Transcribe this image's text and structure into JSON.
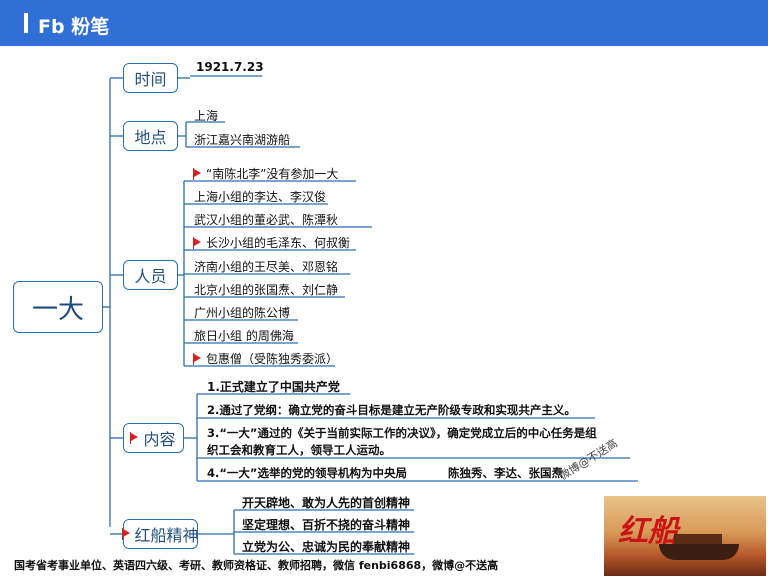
{
  "brand": {
    "name": "粉笔",
    "logo_text": "Fb",
    "color": "#2f6fd6"
  },
  "root": {
    "label": "一大"
  },
  "branches": {
    "time": {
      "label": "时间",
      "items": [
        "1921.7.23"
      ]
    },
    "place": {
      "label": "地点",
      "items": [
        "上海",
        "浙江嘉兴南湖游船"
      ]
    },
    "people": {
      "label": "人员",
      "items": [
        "“南陈北李”没有参加一大",
        "上海小组的李达、李汉俊",
        "武汉小组的董必武、陈潭秋",
        "长沙小组的毛泽东、何叔衡",
        "济南小组的王尽美、邓恩铭",
        "北京小组的张国焘、刘仁静",
        "广州小组的陈公博",
        "旅日小组 的周佛海",
        "包惠僧（受陈独秀委派）"
      ]
    },
    "content": {
      "label": "内容",
      "items": [
        "1.正式建立了中国共产党",
        "2.通过了党纲：确立党的奋斗目标是建立无产阶级专政和实现共产主义。",
        "3.“一大”通过的《关于当前实际工作的决议》，确定党成立后的中心任务是组",
        "织工会和教育工人，领导工人运动。",
        "4.“一大”选举的党的领导机构为中央局",
        "陈独秀、李达、张国焘"
      ]
    },
    "spirit": {
      "label": "红船精神",
      "items": [
        "开天辟地、敢为人先的首创精神",
        "坚定理想、百折不挠的奋斗精神",
        "立党为公、忠诚为民的奉献精神"
      ]
    }
  },
  "watermark": "微博@不送高",
  "footer": "国考省考事业单位、英语四六级、考研、教师资格证、教师招聘，微信 fenbi6868，微博@不送高",
  "image_caption": "红船",
  "colors": {
    "node_border": "#2a6db0",
    "flag": "#d72020",
    "line": "#2a6db0"
  }
}
